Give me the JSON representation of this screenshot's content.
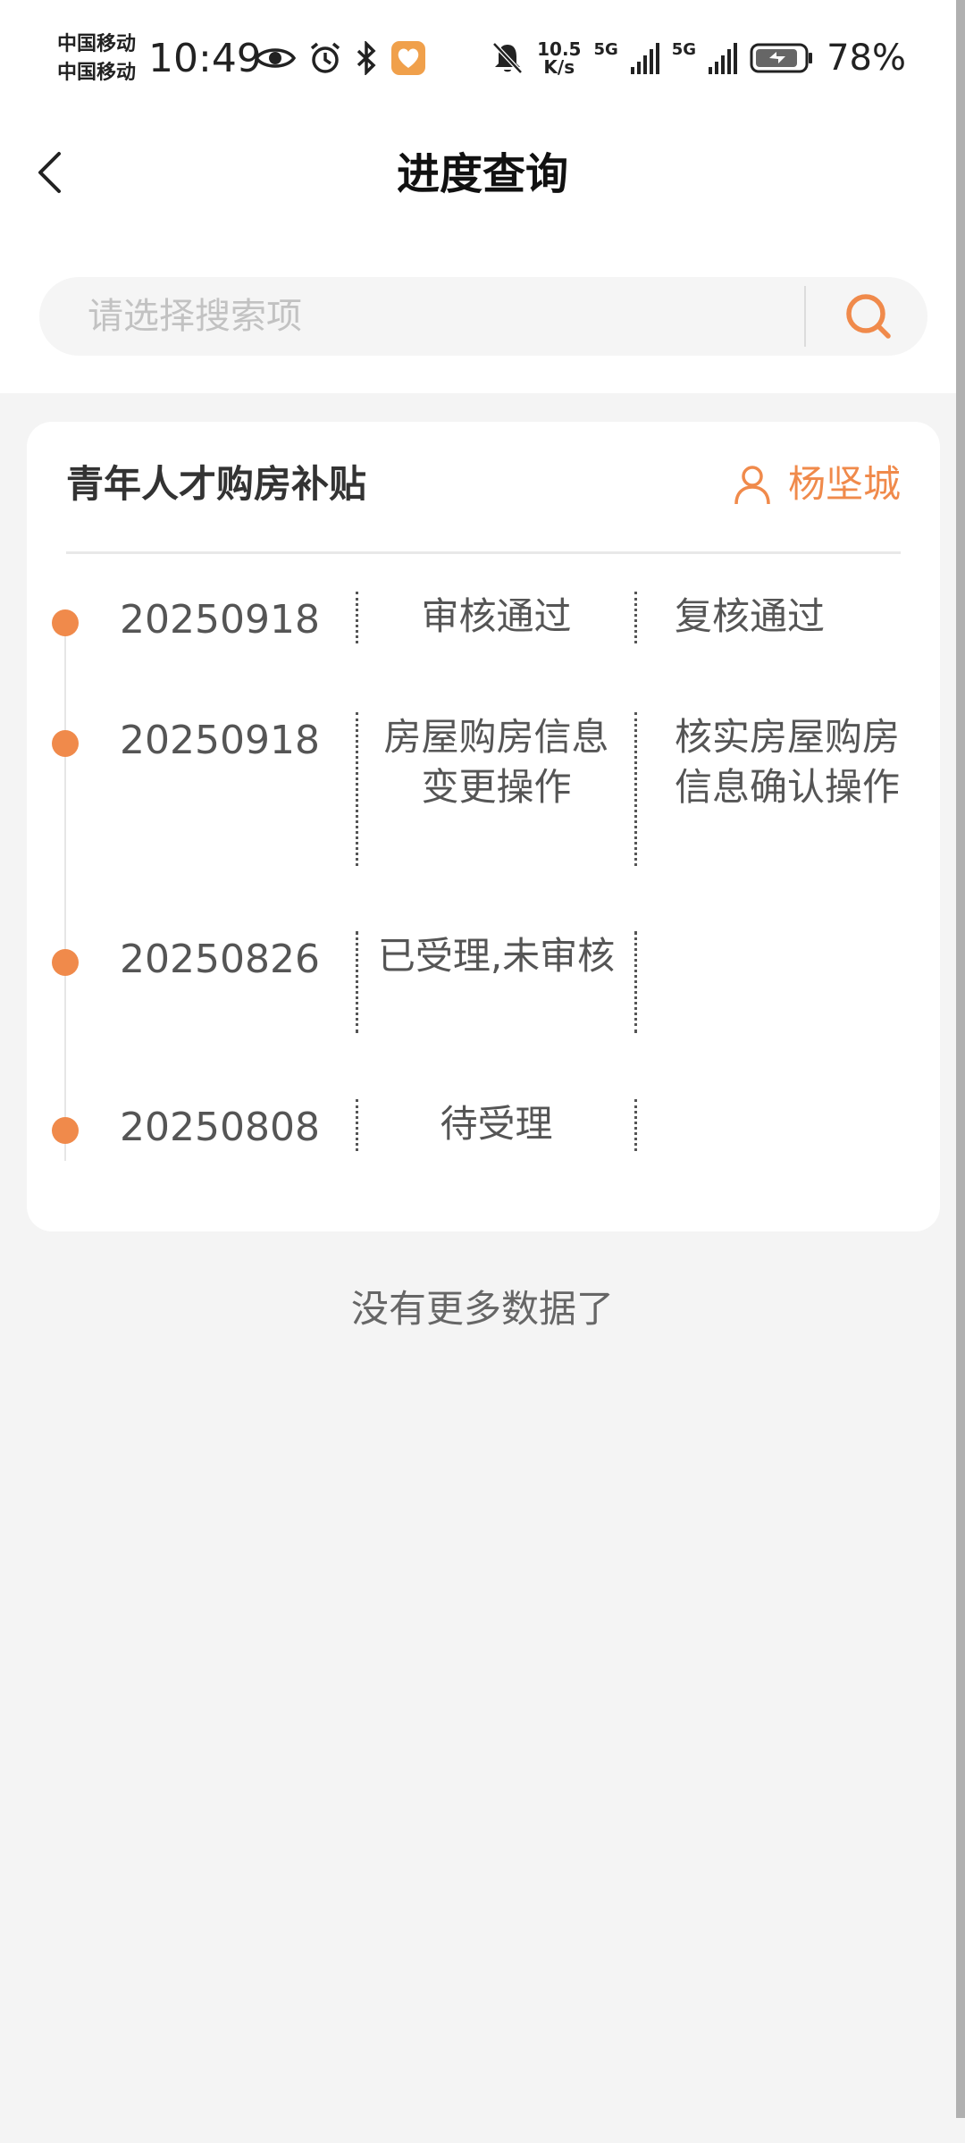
{
  "status_bar": {
    "carrier_1": "中国移动",
    "carrier_2": "中国移动",
    "time": "10:49",
    "net_speed_value": "10.5",
    "net_speed_unit": "K/s",
    "signal_1_label": "5G",
    "signal_2_label": "5G",
    "battery_percent": "78%"
  },
  "nav": {
    "title": "进度查询"
  },
  "search": {
    "placeholder": "请选择搜索项"
  },
  "card": {
    "title": "青年人才购房补贴",
    "user_name": "杨坚城",
    "records": [
      {
        "date": "20250918",
        "status": "审核通过",
        "desc": "复核通过"
      },
      {
        "date": "20250918",
        "status": "房屋购房信息变更操作",
        "desc": "核实房屋购房信息确认操作"
      },
      {
        "date": "20250826",
        "status": "已受理,未审核",
        "desc": ""
      },
      {
        "date": "20250808",
        "status": "待受理",
        "desc": ""
      }
    ]
  },
  "footer": {
    "no_more_text": "没有更多数据了"
  },
  "colors": {
    "accent": "#f08a4b",
    "background": "#f4f4f4",
    "card": "#ffffff"
  }
}
